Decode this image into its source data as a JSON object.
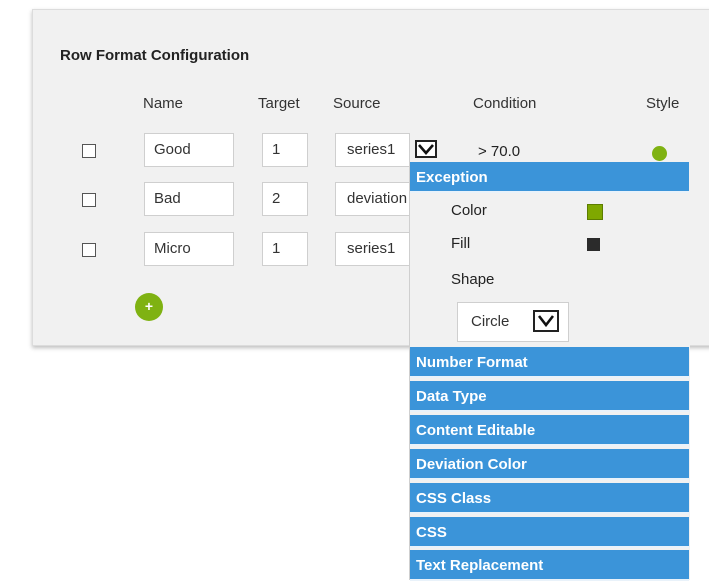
{
  "title": "Row Format Configuration",
  "columns": {
    "name": "Name",
    "target": "Target",
    "source": "Source",
    "condition": "Condition",
    "style": "Style"
  },
  "rows": [
    {
      "name": "Good",
      "target": "1",
      "source": "series1",
      "condition": "> 70.0",
      "style_color": "#7fb212"
    },
    {
      "name": "Bad",
      "target": "2",
      "source": "deviation",
      "condition": "",
      "style_color": ""
    },
    {
      "name": "Micro",
      "target": "1",
      "source": "series1",
      "condition": "",
      "style_color": ""
    }
  ],
  "add_button": "+",
  "popup": {
    "exception_header": "Exception",
    "color_label": "Color",
    "color_value": "#7fa800",
    "fill_label": "Fill",
    "fill_value": "#2b2b2b",
    "shape_label": "Shape",
    "shape_value": "Circle",
    "sections": [
      "Number Format",
      "Data Type",
      "Content Editable",
      "Deviation Color",
      "CSS Class",
      "CSS",
      "Text Replacement"
    ]
  },
  "colors": {
    "accent_green": "#7fb212",
    "accordion_blue": "#3b94d9"
  }
}
